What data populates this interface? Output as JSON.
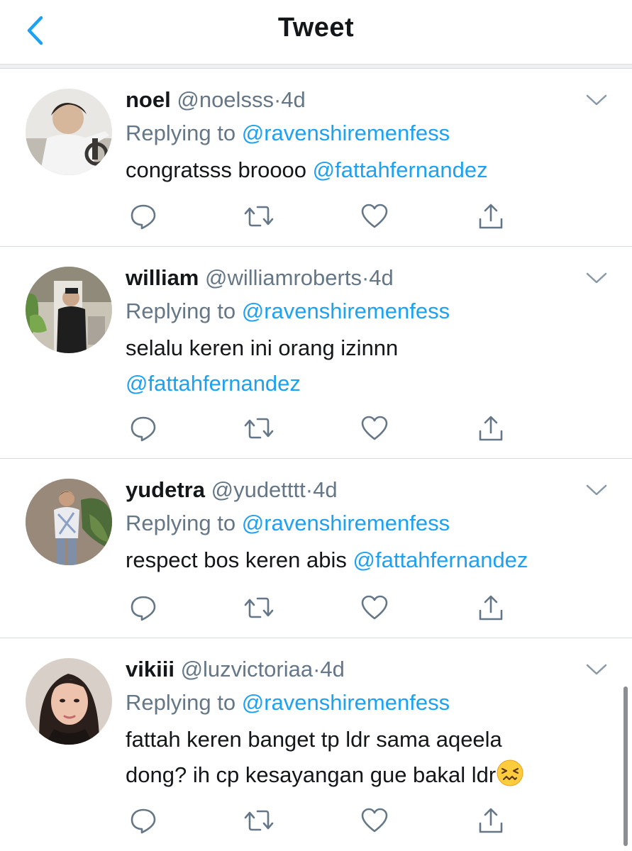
{
  "header": {
    "title": "Tweet",
    "back_icon": "chevron-left-icon"
  },
  "colors": {
    "accent": "#1da1f2",
    "muted": "#657786",
    "divider": "#d9dde0"
  },
  "tweets": [
    {
      "name": "noel",
      "handle": "@noelsss",
      "dot": "·",
      "time": "4d",
      "replying_prefix": "Replying to ",
      "replying_to": "@ravenshiremenfess",
      "text": "congratsss broooo ",
      "text_mention": "@fattahfernandez"
    },
    {
      "name": "william",
      "handle": "@williamroberts",
      "dot": "·",
      "time": "4d",
      "replying_prefix": "Replying to ",
      "replying_to": "@ravenshiremenfess",
      "text": "selalu keren ini orang izinnn",
      "text_mention": "@fattahfernandez"
    },
    {
      "name": "yudetra",
      "handle": "@yudetttt",
      "dot": "·",
      "time": "4d",
      "replying_prefix": "Replying to ",
      "replying_to": "@ravenshiremenfess",
      "text": "respect bos keren abis ",
      "text_mention": "@fattahfernandez"
    },
    {
      "name": "vikiii",
      "handle": "@luzvictoriaa",
      "dot": "·",
      "time": "4d",
      "replying_prefix": "Replying to ",
      "replying_to": "@ravenshiremenfess",
      "text_line1": "fattah keren banget tp ldr sama aqeela",
      "text_line2": "dong? ih cp kesayangan gue bakal ldr",
      "emoji": "confounded-face-emoji"
    }
  ],
  "actions": [
    "reply-icon",
    "retweet-icon",
    "like-icon",
    "share-icon"
  ]
}
